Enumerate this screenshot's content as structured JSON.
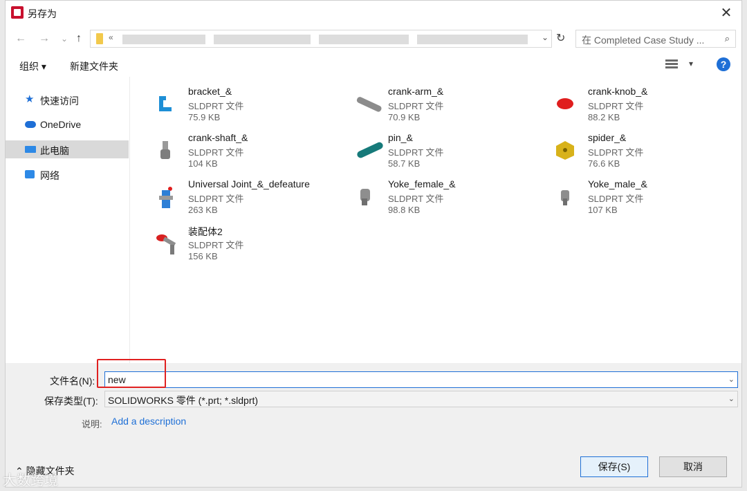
{
  "window": {
    "title": "另存为",
    "close_glyph": "✕"
  },
  "nav": {
    "back": "←",
    "forward": "→",
    "recent": "⌄",
    "up": "↑",
    "refresh": "↻"
  },
  "address": {
    "chevron": "«",
    "dropdown": "⌄"
  },
  "search": {
    "placeholder": "在 Completed Case Study ...",
    "icon": "⌕"
  },
  "toolbar": {
    "organize": "组织 ▾",
    "new_folder": "新建文件夹",
    "view_dropdown": "▾",
    "help": "?"
  },
  "sidebar": {
    "items": [
      {
        "label": "快速访问",
        "icon": "star-icon"
      },
      {
        "label": "OneDrive",
        "icon": "cloud-icon"
      },
      {
        "label": "此电脑",
        "icon": "computer-icon",
        "selected": true
      },
      {
        "label": "网络",
        "icon": "network-icon"
      }
    ]
  },
  "files": [
    {
      "name": "bracket_&",
      "type": "SLDPRT 文件",
      "size": "75.9 KB",
      "color": "#1e8fd6"
    },
    {
      "name": "crank-arm_&",
      "type": "SLDPRT 文件",
      "size": "70.9 KB",
      "color": "#8c8c8c"
    },
    {
      "name": "crank-knob_&",
      "type": "SLDPRT 文件",
      "size": "88.2 KB",
      "color": "#e01e1e"
    },
    {
      "name": "crank-shaft_&",
      "type": "SLDPRT 文件",
      "size": "104 KB",
      "color": "#9a9a9a"
    },
    {
      "name": "pin_&",
      "type": "SLDPRT 文件",
      "size": "58.7 KB",
      "color": "#167a7a"
    },
    {
      "name": "spider_&",
      "type": "SLDPRT 文件",
      "size": "76.6 KB",
      "color": "#d8b21a"
    },
    {
      "name": "Universal Joint_&_defeature",
      "type": "SLDPRT 文件",
      "size": "263 KB",
      "color": "#2d7fd6"
    },
    {
      "name": "Yoke_female_&",
      "type": "SLDPRT 文件",
      "size": "98.8 KB",
      "color": "#8e8e8e"
    },
    {
      "name": "Yoke_male_&",
      "type": "SLDPRT 文件",
      "size": "107 KB",
      "color": "#8e8e8e"
    },
    {
      "name": "装配体2",
      "type": "SLDPRT 文件",
      "size": "156 KB",
      "color": "#d82020"
    }
  ],
  "form": {
    "filename_label": "文件名(N):",
    "filename_value": "new",
    "filetype_label": "保存类型(T):",
    "filetype_value": "SOLIDWORKS 零件 (*.prt; *.sldprt)",
    "description_label": "说明:",
    "description_link": "Add a description",
    "hide_folders": "⌃ 隐藏文件夹",
    "save": "保存(S)",
    "cancel": "取消",
    "dropdown": "⌄"
  },
  "watermark": "大数跨境"
}
